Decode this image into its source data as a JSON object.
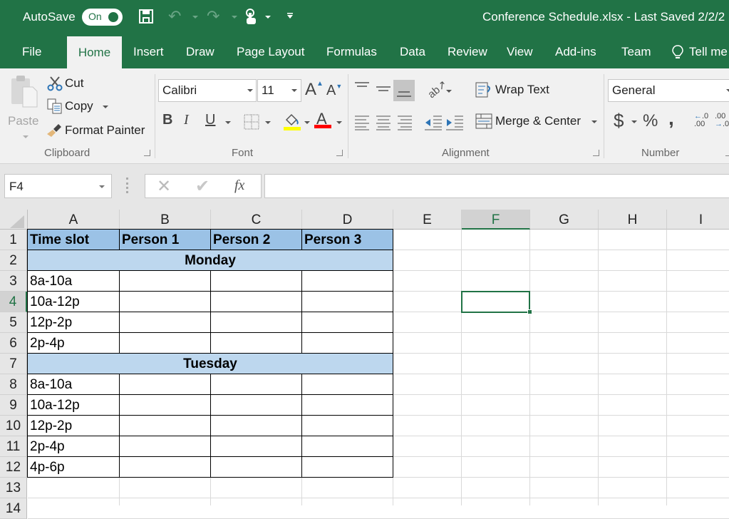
{
  "title_bar": {
    "autosave_label": "AutoSave",
    "autosave_state": "On",
    "document_title": "Conference Schedule.xlsx  -  Last Saved 2/2/2"
  },
  "ribbon_tabs": [
    {
      "label": "File",
      "active": false
    },
    {
      "label": "Home",
      "active": true
    },
    {
      "label": "Insert",
      "active": false
    },
    {
      "label": "Draw",
      "active": false
    },
    {
      "label": "Page Layout",
      "active": false
    },
    {
      "label": "Formulas",
      "active": false
    },
    {
      "label": "Data",
      "active": false
    },
    {
      "label": "Review",
      "active": false
    },
    {
      "label": "View",
      "active": false
    },
    {
      "label": "Add-ins",
      "active": false
    },
    {
      "label": "Team",
      "active": false
    }
  ],
  "tell_me": "Tell me",
  "clipboard": {
    "group_label": "Clipboard",
    "paste": "Paste",
    "cut": "Cut",
    "copy": "Copy",
    "format_painter": "Format Painter"
  },
  "font": {
    "group_label": "Font",
    "font_name": "Calibri",
    "font_size": "11",
    "bold": "B",
    "italic": "I",
    "underline": "U",
    "fill_color": "#ffff00",
    "font_color": "#ff0000"
  },
  "alignment": {
    "group_label": "Alignment",
    "wrap_text": "Wrap Text",
    "merge_center": "Merge & Center"
  },
  "number": {
    "group_label": "Number",
    "format": "General",
    "currency": "$",
    "percent": "%",
    "comma": ","
  },
  "formula_bar": {
    "name_box": "F4",
    "formula": ""
  },
  "sheet": {
    "columns": [
      "A",
      "B",
      "C",
      "D",
      "E",
      "F",
      "G",
      "H",
      "I"
    ],
    "selected_column": "F",
    "rows": [
      "1",
      "2",
      "3",
      "4",
      "5",
      "6",
      "7",
      "8",
      "9",
      "10",
      "11",
      "12",
      "13",
      "14"
    ],
    "selected_row": "4",
    "selected_cell": "F4",
    "header_row": [
      "Time slot",
      "Person 1",
      "Person 2",
      "Person 3"
    ],
    "day_headers": {
      "row2": "Monday",
      "row7": "Tuesday"
    },
    "time_slots": {
      "r3": "8a-10a",
      "r4": "10a-12p",
      "r5": "12p-2p",
      "r6": "2p-4p",
      "r8": "8a-10a",
      "r9": "10a-12p",
      "r10": "12p-2p",
      "r11": "2p-4p",
      "r12": "4p-6p"
    },
    "colors": {
      "header_fill": "#9bc2e6",
      "day_fill": "#bdd7ee",
      "accent": "#217346"
    }
  }
}
